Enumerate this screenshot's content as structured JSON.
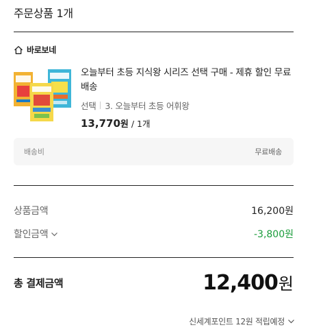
{
  "section": {
    "title": "주문상품 1개"
  },
  "store": {
    "name": "바로보네"
  },
  "product": {
    "name": "오늘부터 초등 지식왕 시리즈 선택 구매 - 제휴 할인 무료배송",
    "option_label": "선택",
    "option_value": "3. 오늘부터 초등 어휘왕",
    "price": "13,770",
    "currency": "원",
    "quantity": "/ 1개",
    "book_titles": [
      "오늘부터 초등 지식왕 2",
      "초등 한자왕",
      "오늘부터 초등 어휘왕"
    ],
    "book_colors": [
      "#f2b233",
      "#f5d84a",
      "#3fb6d8"
    ]
  },
  "shipping": {
    "label": "배송비",
    "value": "무료배송"
  },
  "summary": {
    "product_amount_label": "상품금액",
    "product_amount_value": "16,200원",
    "discount_label": "할인금액",
    "discount_value": "-3,800원",
    "discount_color": "#1a9c3b"
  },
  "total": {
    "label": "총 결제금액",
    "amount": "12,400",
    "currency": "원"
  },
  "points": {
    "text": "신세계포인트 12원 적립예정"
  }
}
